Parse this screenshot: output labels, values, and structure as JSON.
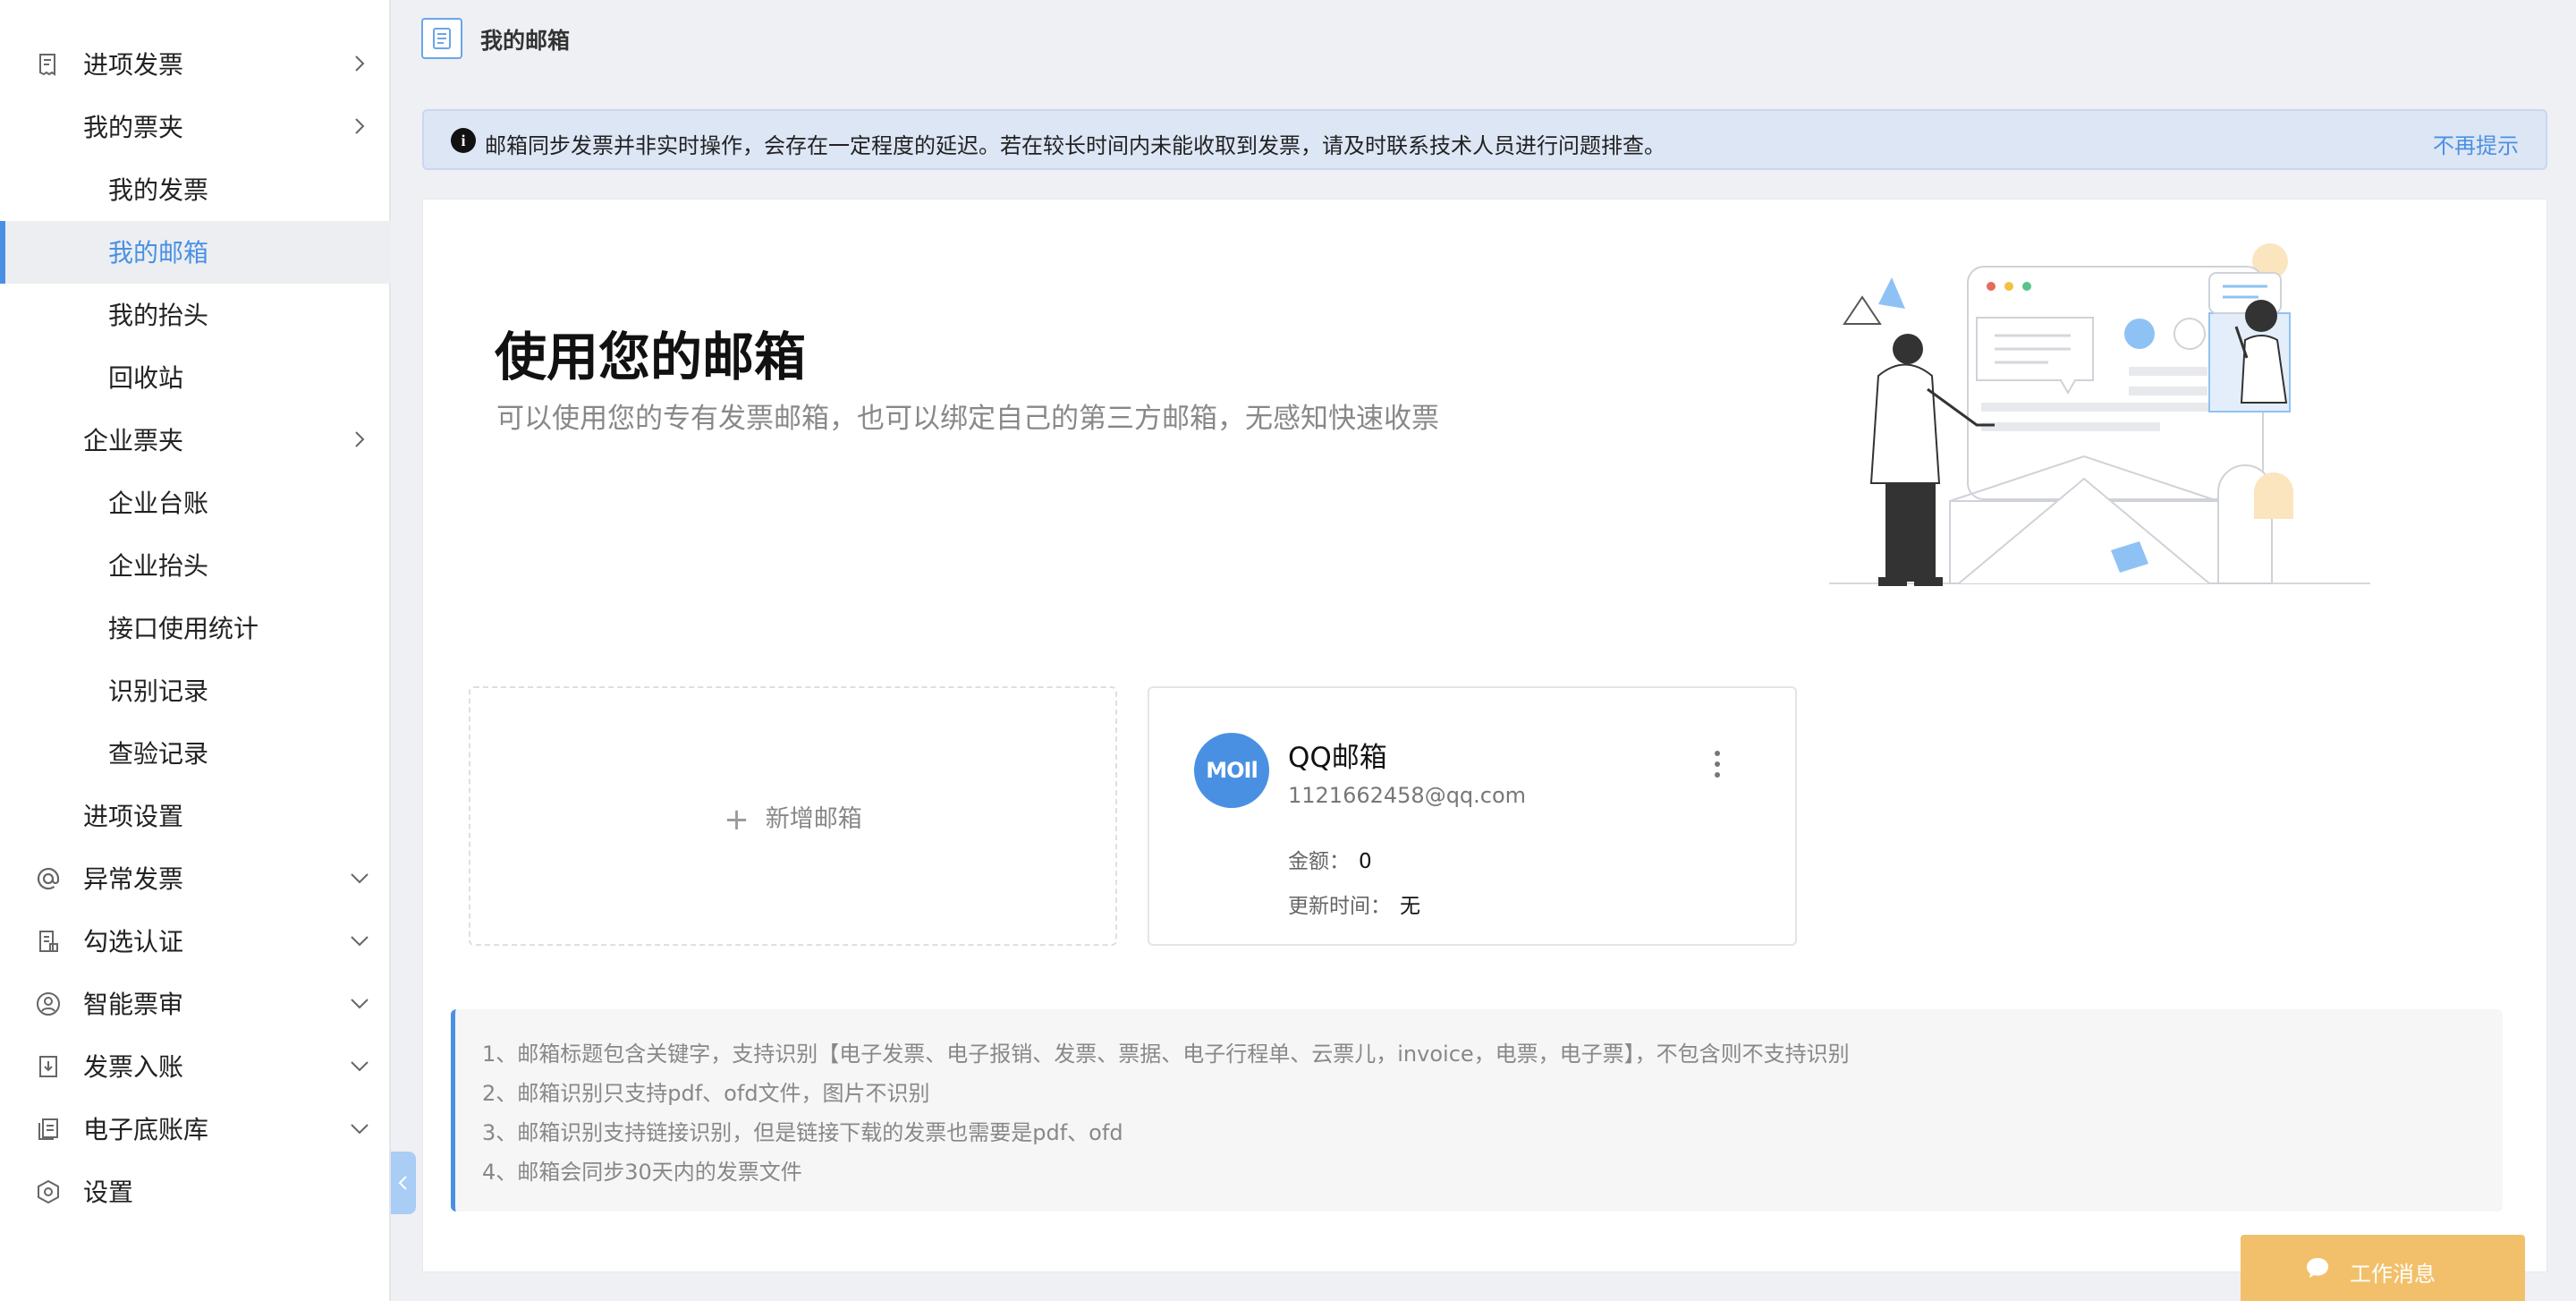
{
  "sidebar": {
    "items": [
      {
        "label": "进项发票",
        "icon": "invoice-in-icon",
        "chevron": "right"
      },
      {
        "label": "我的票夹",
        "chevron": "right"
      },
      {
        "label": "我的发票"
      },
      {
        "label": "我的邮箱",
        "active": true
      },
      {
        "label": "我的抬头"
      },
      {
        "label": "回收站"
      },
      {
        "label": "企业票夹",
        "chevron": "right"
      },
      {
        "label": "企业台账"
      },
      {
        "label": "企业抬头"
      },
      {
        "label": "接口使用统计"
      },
      {
        "label": "识别记录"
      },
      {
        "label": "查验记录"
      },
      {
        "label": "进项设置"
      },
      {
        "label": "异常发票",
        "icon": "at-icon",
        "chevron": "down"
      },
      {
        "label": "勾选认证",
        "icon": "checklist-doc-icon",
        "chevron": "down"
      },
      {
        "label": "智能票审",
        "icon": "user-circle-icon",
        "chevron": "down"
      },
      {
        "label": "发票入账",
        "icon": "download-doc-icon",
        "chevron": "down"
      },
      {
        "label": "电子底账库",
        "icon": "copy-doc-icon",
        "chevron": "down"
      },
      {
        "label": "设置",
        "icon": "settings-hex-icon"
      }
    ]
  },
  "header": {
    "title": "我的邮箱",
    "icon": "document-icon"
  },
  "notice": {
    "text": "邮箱同步发票并非实时操作，会存在一定程度的延迟。若在较长时间内未能收取到发票，请及时联系技术人员进行问题排查。",
    "dismiss": "不再提示"
  },
  "hero": {
    "title": "使用您的邮箱",
    "subtitle": "可以使用您的专有发票邮箱，也可以绑定自己的第三方邮箱，无感知快速收票"
  },
  "add_card": {
    "label": "新增邮箱"
  },
  "mailbox": {
    "logo_text": "MOIl",
    "name": "QQ邮箱",
    "address": "1121662458@qq.com",
    "amount_label": "金额：",
    "amount_value": "0",
    "updated_label": "更新时间：",
    "updated_value": "无"
  },
  "tips": [
    "1、邮箱标题包含关键字，支持识别【电子发票、电子报销、发票、票据、电子行程单、云票儿，invoice，电票，电子票】，不包含则不支持识别",
    "2、邮箱识别只支持pdf、ofd文件，图片不识别",
    "3、邮箱识别支持链接识别，但是链接下载的发票也需要是pdf、ofd",
    "4、邮箱会同步30天内的发票文件"
  ],
  "chat": {
    "label": "工作消息"
  },
  "colors": {
    "accent": "#4a90e2",
    "chat": "#f2c06a",
    "notice_bg": "#dde6f5"
  }
}
